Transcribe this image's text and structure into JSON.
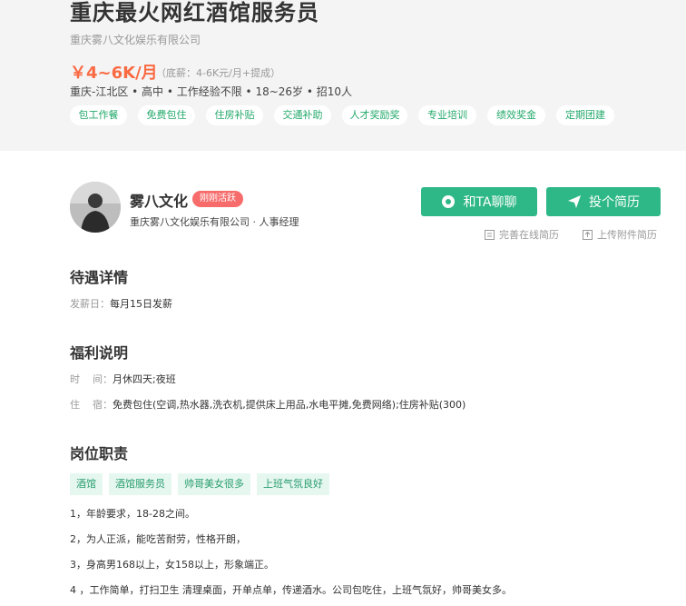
{
  "job": {
    "title": "重庆最火网红酒馆服务员",
    "company": "重庆雾八文化娱乐有限公司",
    "salary": "￥4~6K/月",
    "salary_note": "（底薪：4-6K元/月+提成）",
    "meta": "重庆-江北区 • 高中 • 工作经验不限  • 18~26岁 • 招10人",
    "tags": [
      "包工作餐",
      "免费包住",
      "住房补贴",
      "交通补助",
      "人才奖励奖",
      "专业培训",
      "绩效奖金",
      "定期团建"
    ]
  },
  "recruiter": {
    "name": "雾八文化",
    "badge": "刚刚活跃",
    "info": "重庆雾八文化娱乐有限公司 · 人事经理"
  },
  "actions": {
    "chat": "和TA聊聊",
    "resume": "投个简历",
    "online_resume": "完善在线简历",
    "attach_resume": "上传附件简历"
  },
  "benefits": {
    "title": "待遇详情",
    "pay_label": "发薪日：",
    "pay_value": "每月15日发薪"
  },
  "welfare": {
    "title": "福利说明",
    "time_label": "时    间：",
    "time_value": "月休四天;夜班",
    "stay_label": "住    宿：",
    "stay_value": "免费包住(空调,热水器,洗衣机,提供床上用品,水电平摊,免费网络);住房补贴(300)"
  },
  "duties": {
    "title": "岗位职责",
    "tags": [
      "酒馆",
      "酒馆服务员",
      "帅哥美女很多",
      "上班气氛良好"
    ],
    "lines": [
      "1，年龄要求，18-28之间。",
      "2，为人正派，能吃苦耐劳，性格开朗，",
      "3，身高男168以上，女158以上，形象端正。",
      "4 ，工作简单，打扫卫生 清理桌面，开单点单，传递酒水。公司包吃住，上班气氛好，帅哥美女多。"
    ]
  },
  "colors": {
    "accent": "#2eb887",
    "salary": "#fa6a43",
    "badge": "#f76b6b"
  }
}
